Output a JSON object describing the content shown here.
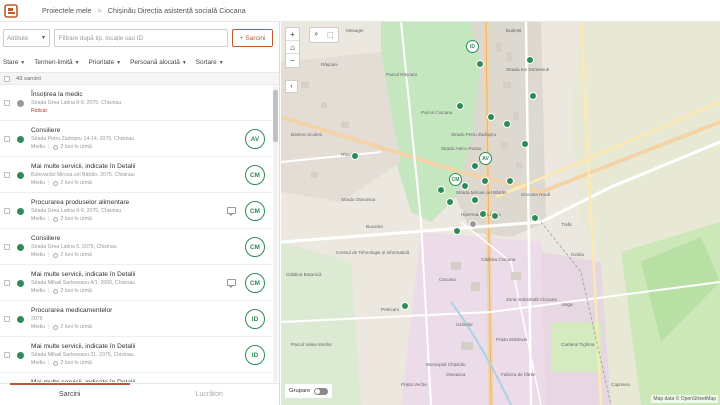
{
  "header": {
    "breadcrumbs": [
      "Proiectele mele",
      "Chișinău Direcția asistență socială Ciocana"
    ]
  },
  "search": {
    "attribute_placeholder": "Atribute",
    "filter_placeholder": "Filtrare după tip, locație sau ID",
    "add_label": "Sarcini"
  },
  "filters": [
    "Stare",
    "Termen-limită",
    "Prioritate",
    "Persoană alocată",
    "Sortare"
  ],
  "count_label": "43 sarcini",
  "tasks": [
    {
      "title": "Însoțirea la medic",
      "address": "Strada Grea Latina 9-9, 2075, Chisinau",
      "priority": "Ridicat",
      "time": "",
      "avatar": "",
      "status": "grey",
      "chat": false
    },
    {
      "title": "Consiliere",
      "address": "Strada Petru Zadnipru 14-14, 2075, Chisinau",
      "priority": "Mediu",
      "time": "2 luni în urmă",
      "avatar": "AV",
      "status": "green",
      "chat": false
    },
    {
      "title": "Mai multe servicii, indicate în Detalii",
      "address": "Bulevardul Mircea cel Bătrân, 2075, Chisinau",
      "priority": "Mediu",
      "time": "2 luni în urmă",
      "avatar": "CM",
      "status": "green",
      "chat": false
    },
    {
      "title": "Procurarea produselor alimentare",
      "address": "Strada Grea Latina 9-9, 2075, Chisinau",
      "priority": "Mediu",
      "time": "2 luni în urmă",
      "avatar": "CM",
      "status": "green",
      "chat": true
    },
    {
      "title": "Consiliere",
      "address": "Strada Grea Latina 5, 2075, Chisinau",
      "priority": "Mediu",
      "time": "2 luni în urmă",
      "avatar": "CM",
      "status": "green",
      "chat": false
    },
    {
      "title": "Mai multe servicii, indicate în Detalii",
      "address": "Strada Mihail Sadoveanu 4/1, 2060, Chisinau",
      "priority": "Mediu",
      "time": "2 luni în urmă",
      "avatar": "CM",
      "status": "green",
      "chat": true
    },
    {
      "title": "Procurarea medicamentelor",
      "address": "2075",
      "priority": "Mediu",
      "time": "2 luni în urmă",
      "avatar": "ID",
      "status": "green",
      "chat": false
    },
    {
      "title": "Mai multe servicii, indicate în Detalii",
      "address": "Strada Mihail Sadoveanu 21, 2075, Chisinau",
      "priority": "Mediu",
      "time": "2 luni în urmă",
      "avatar": "ID",
      "status": "green",
      "chat": false
    },
    {
      "title": "Mai multe servicii, indicate în Detalii",
      "address": "",
      "priority": "",
      "time": "",
      "avatar": "",
      "status": "green",
      "chat": false
    }
  ],
  "bottom_tabs": [
    "Sarcini",
    "Lucrători"
  ],
  "map": {
    "grouping_label": "Grupare",
    "attribution": "Map data © OpenStreetMap",
    "labels": [
      "Mesager",
      "Parcul Ciocana",
      "Parcul Râșcani",
      "Râșcani",
      "Strada Petru Zadnipru",
      "Strada Alecu Russo",
      "Strada Ion Dumeniuk",
      "Strada Mircea cel Bătrân",
      "Strada Otovasca",
      "Ciocana",
      "Municipiul Chișinău",
      "Otovasca",
      "Zona industrială Ciocana",
      "Centrul de Tehnologie și Informatică",
      "Petricani",
      "Uzinelor",
      "Budești",
      "Bucuriei",
      "Poșta Moldovei",
      "Fabrica de hârtie",
      "Hipermarket Linella",
      "Trafic",
      "Bariera Sculeni",
      "Grădina Botanică",
      "Ciocana Nouă",
      "Poșta Veche",
      "Ovidiu",
      "Volga",
      "Cartierul Tighina",
      "Capriana",
      "Parcul Valea Morilor",
      "Cădirea Ciocana",
      "Rîșcani"
    ],
    "markers_av": [
      "ID",
      "AV",
      "CM"
    ]
  }
}
